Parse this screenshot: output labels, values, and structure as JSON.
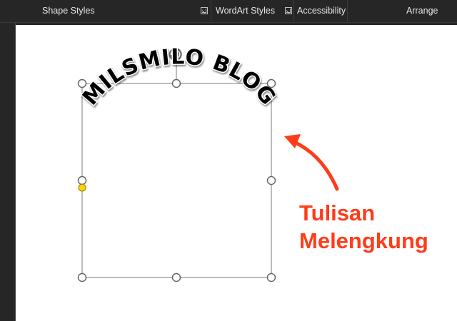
{
  "ribbon": {
    "groups": [
      {
        "label": "Shape Styles",
        "launcher": true
      },
      {
        "label": "WordArt Styles",
        "launcher": true
      },
      {
        "label": "Accessibility",
        "launcher": false
      },
      {
        "label": "Arrange",
        "launcher": false
      }
    ]
  },
  "wordart": {
    "text": "MILSMILO BLOG",
    "effect": "arch-up",
    "fill_color": "#000000",
    "outline_color": "#ffffff"
  },
  "annotation": {
    "line1": "Tulisan",
    "line2": "Melengkung",
    "color": "#ff3c1a",
    "arrow_icon": "curved-arrow-icon"
  },
  "selection": {
    "handle_color": "#ffffff",
    "adjust_handle_color": "#ffd400",
    "rotate_icon": "rotate-icon"
  }
}
